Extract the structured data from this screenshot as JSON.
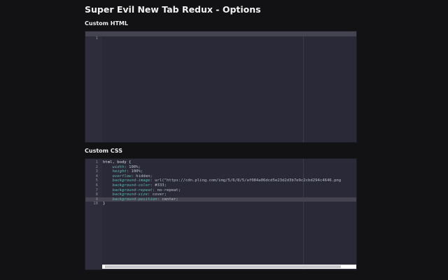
{
  "title": "Super Evil New Tab Redux - Options",
  "html_section": {
    "label": "Custom HTML",
    "lines": [
      {
        "num": "1",
        "code": ""
      }
    ]
  },
  "css_section": {
    "label": "Custom CSS",
    "lines": [
      {
        "num": "1",
        "sel": "html, body {",
        "prop": "",
        "val": ""
      },
      {
        "num": "2",
        "sel": "    ",
        "prop": "width",
        "val": " 100%;"
      },
      {
        "num": "3",
        "sel": "    ",
        "prop": "height",
        "val": " 100%;"
      },
      {
        "num": "4",
        "sel": "    ",
        "prop": "overflow",
        "val": " hidden;"
      },
      {
        "num": "5",
        "sel": "    ",
        "prop": "background-image",
        "val": " url(\"https://cdn.pling.com/img/5/6/8/5/af084a06dcd5e23d2d3b7e9c2cbd294c4646.png"
      },
      {
        "num": "6",
        "sel": "    ",
        "prop": "background-color",
        "val": " #333;"
      },
      {
        "num": "7",
        "sel": "    ",
        "prop": "background-repeat",
        "val": " no-repeat;"
      },
      {
        "num": "8",
        "sel": "    ",
        "prop": "background-size",
        "val": " cover;"
      },
      {
        "num": "9",
        "sel": "    ",
        "prop": "background-position",
        "val": " center;"
      },
      {
        "num": "10",
        "sel": "}",
        "prop": "",
        "val": ""
      }
    ]
  }
}
